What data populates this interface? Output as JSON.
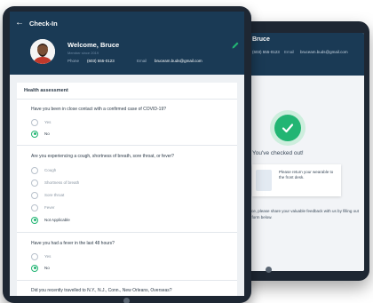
{
  "colors": {
    "header": "#1a3a55",
    "accent": "#22b573",
    "bezel": "#1e2733"
  },
  "back_tablet": {
    "name": "Bruce",
    "phone": "(603) 555-0123",
    "email_label": "Email",
    "email": "bruceam.buds@gmail.com",
    "status_text": "You've checked out!",
    "return_card_text": "Please return your wearable to the front desk.",
    "share_text": "Bruce, please share your valuable feedback with us by filling out the form below."
  },
  "header": {
    "back_icon": "arrow-left-icon",
    "title": "Check-In",
    "welcome": "Welcome, Bruce",
    "subtext": "Member since 2019",
    "phone_label": "Phone",
    "phone": "(603) 555-0123",
    "email_label": "Email",
    "email": "bruceam.buds@gmail.com",
    "edit_icon": "pencil-icon"
  },
  "form": {
    "section_title": "Health assessment",
    "questions": [
      {
        "text": "Have you been in close contact with a confirmed case of COVID-19?",
        "options": [
          "Yes",
          "No"
        ],
        "selected": "No"
      },
      {
        "text": "Are you experiencing a cough, shortness of breath, sore throat, or fever?",
        "options": [
          "Cough",
          "Shortness of breath",
          "Sore throat",
          "Fever",
          "Not Applicable"
        ],
        "selected": "Not Applicable"
      },
      {
        "text": "Have you had a fever in the last 48 hours?",
        "options": [
          "Yes",
          "No"
        ],
        "selected": "No"
      },
      {
        "text": "Did you recently travelled to N.Y., N.J., Conn., New Orleans, Overseas?",
        "options": [],
        "selected": ""
      }
    ]
  }
}
